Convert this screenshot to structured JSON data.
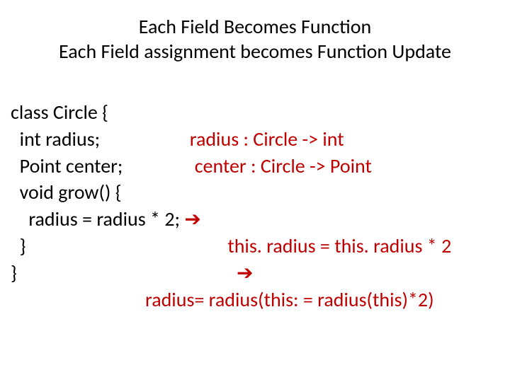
{
  "title": {
    "line1": "Each Field Becomes Function",
    "line2": "Each Field assignment becomes Function Update"
  },
  "code": {
    "l1_left": "class Circle {",
    "l2_left": "  int radius;",
    "l2_right": "radius : Circle -> int",
    "l3_left": "  Point center;",
    "l3_right": "center : Circle -> Point",
    "l4_left": "  void grow() {",
    "l5_left": "    radius = radius * 2;",
    "l5_right": "➔",
    "l6_left": "  }",
    "l6_right": "this. radius = this. radius * 2",
    "l7_left": "}",
    "l7_right": "➔",
    "l8": "radius= radius(this: = radius(this)*2)"
  },
  "layout": {
    "col_gap_l2": "                    ",
    "col_gap_l3": "                ",
    "col_gap_l5": " ",
    "col_gap_l6": "                                             ",
    "col_gap_l7": "                                                 "
  }
}
